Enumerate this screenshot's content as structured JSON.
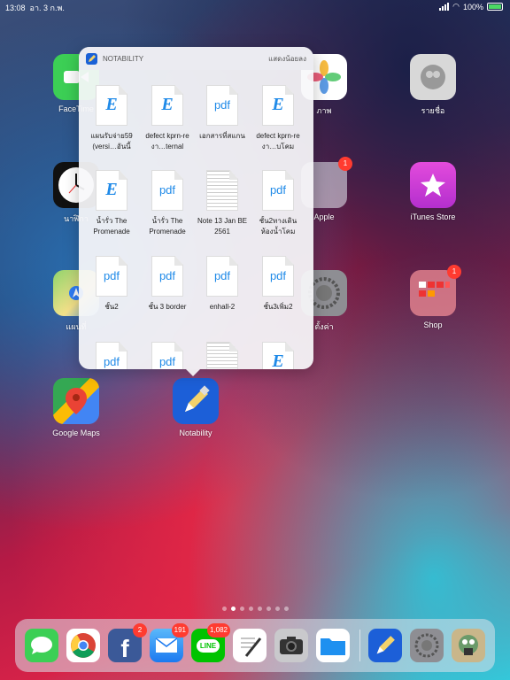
{
  "status": {
    "time": "13:08",
    "date": "อา. 3 ก.พ.",
    "battery": "100%"
  },
  "apps": {
    "facetime": "FaceTime",
    "photos": "ภาพ",
    "contacts": "รายชื่อ",
    "clock": "นาฬิกา",
    "apple_folder": "Apple",
    "itunes": "iTunes Store",
    "maps": "แผนที่",
    "settings": "ตั้งค่า",
    "shop": "Shop",
    "google_maps": "Google Maps",
    "notability": "Notability"
  },
  "badges": {
    "apple_folder": "1",
    "shop": "1"
  },
  "popup": {
    "app_name": "NOTABILITY",
    "show_less": "แสดงน้อยลง",
    "files": [
      {
        "type": "e",
        "name": "แผนรับจ่าย59 (versi…อันนี้"
      },
      {
        "type": "e",
        "name": "defect kprn-re งา…ternal"
      },
      {
        "type": "pdf",
        "name": "เอกสารที่สแกน"
      },
      {
        "type": "e",
        "name": "defect kprn-re งา…บโคม"
      },
      {
        "type": "e",
        "name": "น้ำรั่ว The Promenade"
      },
      {
        "type": "pdf",
        "name": "น้ำรั่ว The Promenade"
      },
      {
        "type": "note",
        "name": "Note 13 Jan BE 2561"
      },
      {
        "type": "pdf",
        "name": "ชั้น2ทางเดิน ห้องน้ำโคม"
      },
      {
        "type": "pdf",
        "name": "ชั้น2"
      },
      {
        "type": "pdf",
        "name": "ชั้น 3 border"
      },
      {
        "type": "pdf",
        "name": "enhall-2"
      },
      {
        "type": "pdf",
        "name": "ชั้น3เพิ่ม2"
      },
      {
        "type": "pdf",
        "name": ""
      },
      {
        "type": "pdf",
        "name": ""
      },
      {
        "type": "note",
        "name": ""
      },
      {
        "type": "e",
        "name": ""
      }
    ],
    "pdf_glyph": "pdf",
    "e_glyph": "E"
  },
  "dock": {
    "badges": {
      "facebook": "2",
      "mail": "191",
      "line": "1,082"
    },
    "line_text": "LINE"
  },
  "colors": {
    "accent": "#1f8ae8",
    "badge": "#ff3b30"
  }
}
